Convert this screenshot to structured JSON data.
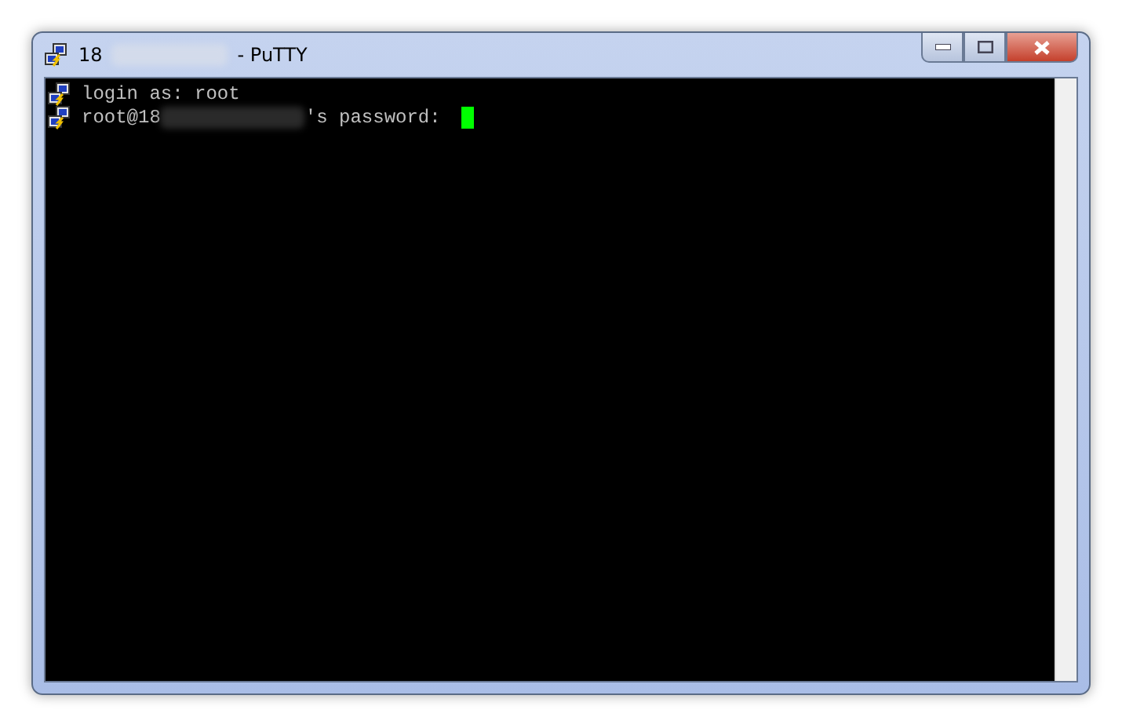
{
  "window": {
    "title_start": "18",
    "title_end": "- PuTTY",
    "controls": [
      {
        "kind": "minimize"
      },
      {
        "kind": "maximize"
      },
      {
        "kind": "close"
      }
    ]
  },
  "terminal": {
    "lines": [
      {
        "kind": "plain",
        "text": "login as: root"
      },
      {
        "kind": "prompt",
        "before": "root@18",
        "after": "'s password:",
        "cursor": true
      }
    ]
  }
}
